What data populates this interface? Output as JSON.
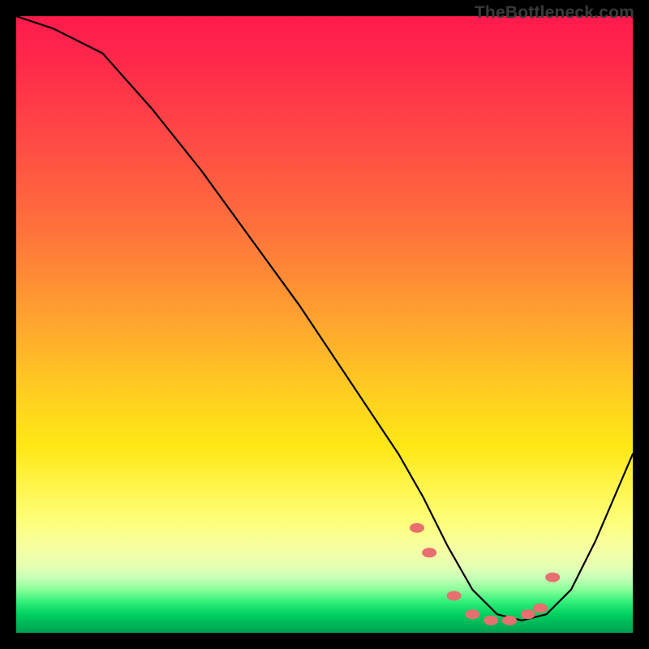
{
  "watermark": "TheBottleneck.com",
  "chart_data": {
    "type": "line",
    "title": "",
    "xlabel": "",
    "ylabel": "",
    "xlim": [
      0,
      100
    ],
    "ylim": [
      0,
      100
    ],
    "grid": false,
    "series": [
      {
        "name": "bottleneck-curve",
        "x": [
          0,
          6,
          14,
          22,
          30,
          38,
          46,
          54,
          62,
          66,
          70,
          74,
          78,
          82,
          86,
          90,
          94,
          100
        ],
        "values": [
          100,
          98,
          94,
          85,
          75,
          64,
          53,
          41,
          29,
          22,
          14,
          7,
          3,
          2,
          3,
          7,
          15,
          29
        ]
      }
    ],
    "markers": {
      "name": "highlight-dots",
      "color": "#e76f6f",
      "x": [
        65,
        67,
        71,
        74,
        77,
        80,
        83,
        85,
        87
      ],
      "values": [
        17,
        13,
        6,
        3,
        2,
        2,
        3,
        4,
        9
      ]
    }
  }
}
